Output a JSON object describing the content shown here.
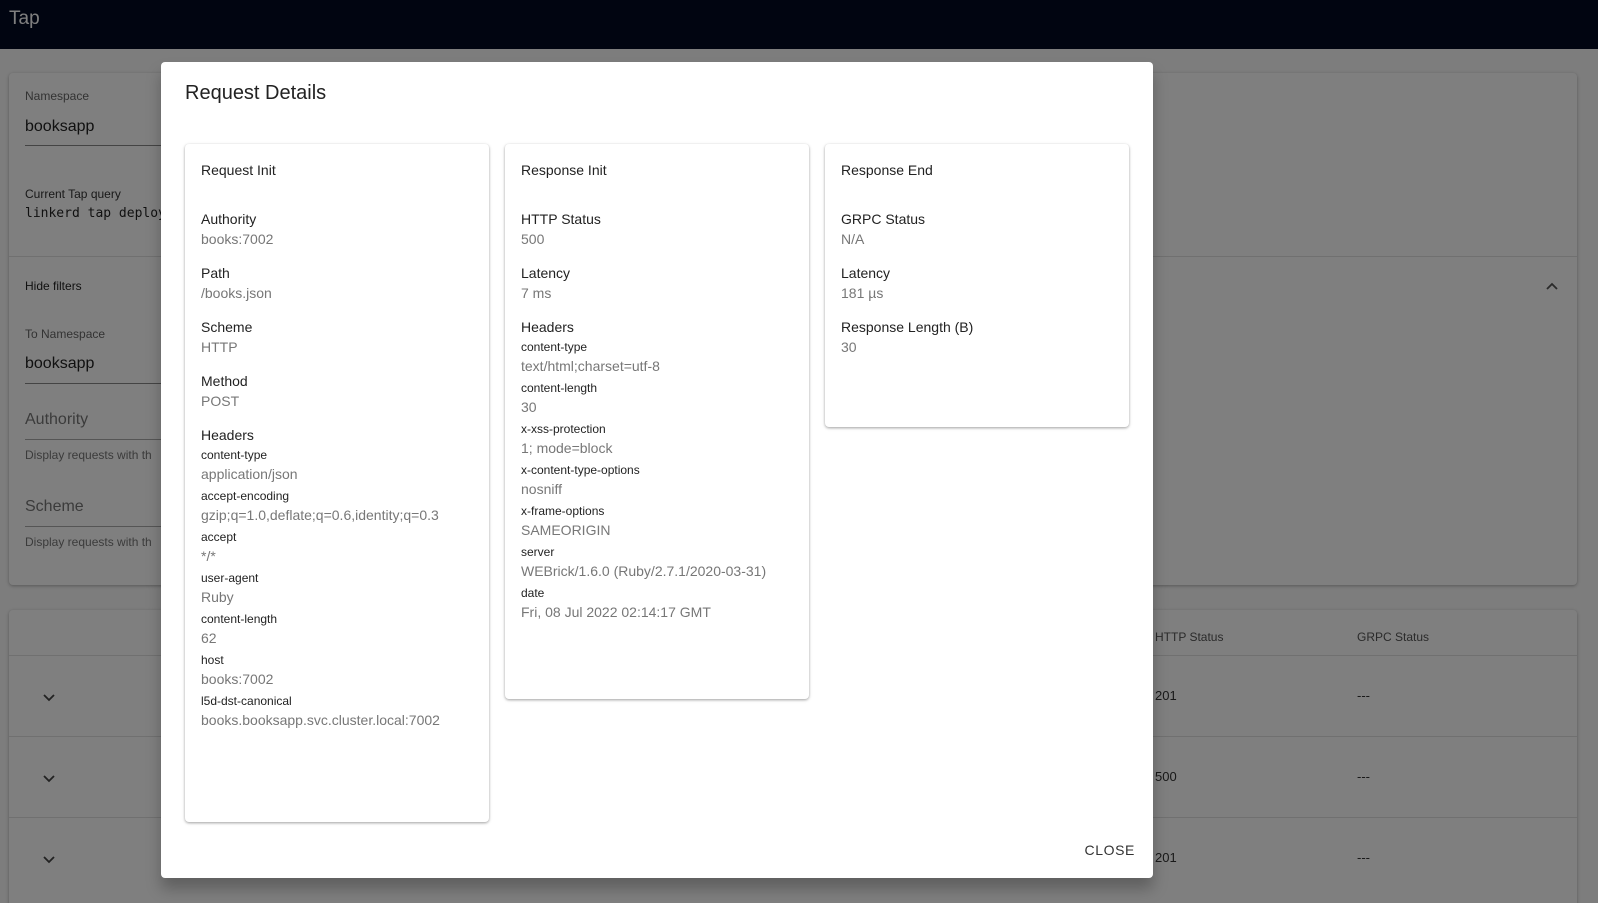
{
  "app": {
    "title": "Tap"
  },
  "filters": {
    "namespace_label": "Namespace",
    "namespace_value": "booksapp",
    "current_query_label": "Current Tap query",
    "current_query_value": "linkerd tap deploym",
    "hide_filters_label": "Hide filters",
    "to_namespace_label": "To Namespace",
    "to_namespace_value": "booksapp",
    "authority_placeholder": "Authority",
    "authority_helper": "Display requests with th",
    "scheme_placeholder": "Scheme",
    "scheme_helper": "Display requests with th"
  },
  "table": {
    "headers": {
      "http_status": "HTTP Status",
      "grpc_status": "GRPC Status"
    },
    "rows": [
      {
        "http_status": "201",
        "grpc_status": "---"
      },
      {
        "http_status": "500",
        "grpc_status": "---"
      },
      {
        "http_status": "201",
        "grpc_status": "---"
      }
    ]
  },
  "modal": {
    "title": "Request Details",
    "close_label": "CLOSE",
    "request_init": {
      "title": "Request Init",
      "authority_label": "Authority",
      "authority_value": "books:7002",
      "path_label": "Path",
      "path_value": "/books.json",
      "scheme_label": "Scheme",
      "scheme_value": "HTTP",
      "method_label": "Method",
      "method_value": "POST",
      "headers_label": "Headers",
      "headers": [
        {
          "key": "content-type",
          "value": "application/json"
        },
        {
          "key": "accept-encoding",
          "value": "gzip;q=1.0,deflate;q=0.6,identity;q=0.3"
        },
        {
          "key": "accept",
          "value": "*/*"
        },
        {
          "key": "user-agent",
          "value": "Ruby"
        },
        {
          "key": "content-length",
          "value": "62"
        },
        {
          "key": "host",
          "value": "books:7002"
        },
        {
          "key": "l5d-dst-canonical",
          "value": "books.booksapp.svc.cluster.local:7002"
        }
      ]
    },
    "response_init": {
      "title": "Response Init",
      "http_status_label": "HTTP Status",
      "http_status_value": "500",
      "latency_label": "Latency",
      "latency_value": "7 ms",
      "headers_label": "Headers",
      "headers": [
        {
          "key": "content-type",
          "value": "text/html;charset=utf-8"
        },
        {
          "key": "content-length",
          "value": "30"
        },
        {
          "key": "x-xss-protection",
          "value": "1; mode=block"
        },
        {
          "key": "x-content-type-options",
          "value": "nosniff"
        },
        {
          "key": "x-frame-options",
          "value": "SAMEORIGIN"
        },
        {
          "key": "server",
          "value": "WEBrick/1.6.0 (Ruby/2.7.1/2020-03-31)"
        },
        {
          "key": "date",
          "value": "Fri, 08 Jul 2022 02:14:17 GMT"
        }
      ]
    },
    "response_end": {
      "title": "Response End",
      "grpc_status_label": "GRPC Status",
      "grpc_status_value": "N/A",
      "latency_label": "Latency",
      "latency_value": "181 µs",
      "response_length_label": "Response Length (B)",
      "response_length_value": "30"
    }
  }
}
